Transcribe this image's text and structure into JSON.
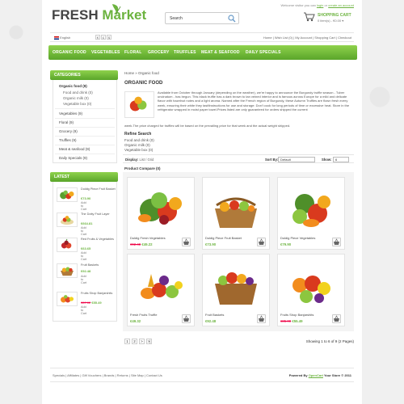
{
  "header": {
    "logo_word1": "FRESH",
    "logo_word2": "Market",
    "welcome_text": "Welcome visitor you can",
    "login": "login",
    "or": "or",
    "create_account": "create an account",
    "search_placeholder": "Search",
    "cart_title": "SHOPPING CART",
    "cart_summary": "0 item(s) - €0.00 ▾"
  },
  "topbar": {
    "language": "English",
    "currencies": [
      "€",
      "£",
      "$"
    ],
    "links": "Home | Wish List (0) | My Account | Shopping Cart | Checkout"
  },
  "nav": [
    "ORGANIC FOOD",
    "VEGETABLES",
    "FLORAL",
    "GROCERY",
    "TRUFFLES",
    "MEAT & SEAFOOD",
    "DAILY SPECIALS"
  ],
  "sidebar": {
    "categories_title": "CATEGORIES",
    "categories": [
      {
        "label": "Organic food (9)",
        "sub": false,
        "selected": true
      },
      {
        "label": "Food and drink (0)",
        "sub": true
      },
      {
        "label": "Organic milk (0)",
        "sub": true
      },
      {
        "label": "Vegetable box (0)",
        "sub": true
      },
      {
        "label": "Vegetables (9)",
        "sub": false
      },
      {
        "label": "Floral (9)",
        "sub": false
      },
      {
        "label": "Grocery (9)",
        "sub": false
      },
      {
        "label": "Truffles (9)",
        "sub": false
      },
      {
        "label": "Meat & seafood (9)",
        "sub": false
      },
      {
        "label": "Daily Specials (9)",
        "sub": false
      }
    ],
    "latest_title": "LATEST",
    "latest": [
      {
        "name": "Duldig Piece Fruit Basket",
        "old": "",
        "price": "€73.90",
        "add": "Add to Cart"
      },
      {
        "name": "The Dotty Fruit Layer",
        "old": "",
        "price": "€664.81",
        "add": "Add to Cart"
      },
      {
        "name": "Red Fruits & Vegetables",
        "old": "",
        "price": "€63.65",
        "add": "Add to Cart"
      },
      {
        "name": "Fruit Baskets",
        "old": "",
        "price": "€92.48",
        "add": "Add to Cart"
      },
      {
        "name": "Fruits Shop Banjarshits",
        "old": "€87.02",
        "price": "€55.49",
        "add": "Add to Cart"
      }
    ]
  },
  "main": {
    "breadcrumb": "Home » Organic food",
    "title": "ORGANIC FOOD",
    "description": "Available from October through January (depending on the weather), we're happy to announce the Burgundy truffle season - Tuber uncinatum - has begun. This black truffle has a dark brown to tan veined interior and is famous across Europe for a mild and delicate flavor with hazelnut notes and a light aroma. Named after the French region of Burgundy, these Autumn Truffles are flown fresh every week, ensuring their white they tastfinstructions for use and storage: Don't cook for long periods of time or excessive heat. Store in the refrigerator wrapped in moist paper towel.Prices listed are only guaranteed for orders shipped the current",
    "description2": "week.The price charged for truffles will be based on the prevailing price for that week and the actual weight shipped.",
    "refine_title": "Refine Search",
    "refine": [
      "Food and drink (0)",
      "Organic milk (0)",
      "Vegetable box (0)"
    ],
    "display_label": "Display:",
    "display_value": "List / Grid",
    "sort_label": "Sort By:",
    "sort_value": "Default",
    "show_label": "Show:",
    "show_value": "6",
    "compare": "Product Compare (0)",
    "products": [
      {
        "name": "Duldig Fresh Vegetables",
        "old": "€92.48",
        "price": "€49.22"
      },
      {
        "name": "Duldig Piece Fruit Basket",
        "old": "",
        "price": "€73.90"
      },
      {
        "name": "Duldig Piece Vegetables",
        "old": "",
        "price": "€79.90"
      },
      {
        "name": "Fresh Fruits Truffle",
        "old": "",
        "price": "€49.32"
      },
      {
        "name": "Fruit Baskets",
        "old": "",
        "price": "€92.48"
      },
      {
        "name": "Fruits Shop Banjarshits",
        "old": "€85.00",
        "price": "€55.49"
      }
    ],
    "pager": [
      "1",
      "2",
      ">",
      ">|"
    ],
    "showing": "Showing 1 to 6 of 9 (2 Pages)"
  },
  "footer": {
    "links": "Specials | Affiliates | Gift Vouchers | Brands | Returns | Site Map | Contact Us",
    "powered": "Powered By",
    "opencart": "OpenCart",
    "rest": "Your Store © 2011"
  },
  "colors": {
    "accent": "#6cb33f",
    "sale": "#e00044"
  }
}
